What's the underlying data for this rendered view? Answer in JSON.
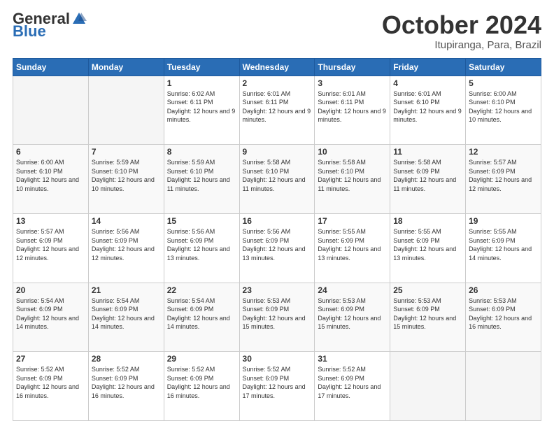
{
  "header": {
    "logo_general": "General",
    "logo_blue": "Blue",
    "month_title": "October 2024",
    "location": "Itupiranga, Para, Brazil"
  },
  "days_of_week": [
    "Sunday",
    "Monday",
    "Tuesday",
    "Wednesday",
    "Thursday",
    "Friday",
    "Saturday"
  ],
  "weeks": [
    [
      {
        "day": "",
        "info": ""
      },
      {
        "day": "",
        "info": ""
      },
      {
        "day": "1",
        "info": "Sunrise: 6:02 AM\nSunset: 6:11 PM\nDaylight: 12 hours and 9 minutes."
      },
      {
        "day": "2",
        "info": "Sunrise: 6:01 AM\nSunset: 6:11 PM\nDaylight: 12 hours and 9 minutes."
      },
      {
        "day": "3",
        "info": "Sunrise: 6:01 AM\nSunset: 6:11 PM\nDaylight: 12 hours and 9 minutes."
      },
      {
        "day": "4",
        "info": "Sunrise: 6:01 AM\nSunset: 6:10 PM\nDaylight: 12 hours and 9 minutes."
      },
      {
        "day": "5",
        "info": "Sunrise: 6:00 AM\nSunset: 6:10 PM\nDaylight: 12 hours and 10 minutes."
      }
    ],
    [
      {
        "day": "6",
        "info": "Sunrise: 6:00 AM\nSunset: 6:10 PM\nDaylight: 12 hours and 10 minutes."
      },
      {
        "day": "7",
        "info": "Sunrise: 5:59 AM\nSunset: 6:10 PM\nDaylight: 12 hours and 10 minutes."
      },
      {
        "day": "8",
        "info": "Sunrise: 5:59 AM\nSunset: 6:10 PM\nDaylight: 12 hours and 11 minutes."
      },
      {
        "day": "9",
        "info": "Sunrise: 5:58 AM\nSunset: 6:10 PM\nDaylight: 12 hours and 11 minutes."
      },
      {
        "day": "10",
        "info": "Sunrise: 5:58 AM\nSunset: 6:10 PM\nDaylight: 12 hours and 11 minutes."
      },
      {
        "day": "11",
        "info": "Sunrise: 5:58 AM\nSunset: 6:09 PM\nDaylight: 12 hours and 11 minutes."
      },
      {
        "day": "12",
        "info": "Sunrise: 5:57 AM\nSunset: 6:09 PM\nDaylight: 12 hours and 12 minutes."
      }
    ],
    [
      {
        "day": "13",
        "info": "Sunrise: 5:57 AM\nSunset: 6:09 PM\nDaylight: 12 hours and 12 minutes."
      },
      {
        "day": "14",
        "info": "Sunrise: 5:56 AM\nSunset: 6:09 PM\nDaylight: 12 hours and 12 minutes."
      },
      {
        "day": "15",
        "info": "Sunrise: 5:56 AM\nSunset: 6:09 PM\nDaylight: 12 hours and 13 minutes."
      },
      {
        "day": "16",
        "info": "Sunrise: 5:56 AM\nSunset: 6:09 PM\nDaylight: 12 hours and 13 minutes."
      },
      {
        "day": "17",
        "info": "Sunrise: 5:55 AM\nSunset: 6:09 PM\nDaylight: 12 hours and 13 minutes."
      },
      {
        "day": "18",
        "info": "Sunrise: 5:55 AM\nSunset: 6:09 PM\nDaylight: 12 hours and 13 minutes."
      },
      {
        "day": "19",
        "info": "Sunrise: 5:55 AM\nSunset: 6:09 PM\nDaylight: 12 hours and 14 minutes."
      }
    ],
    [
      {
        "day": "20",
        "info": "Sunrise: 5:54 AM\nSunset: 6:09 PM\nDaylight: 12 hours and 14 minutes."
      },
      {
        "day": "21",
        "info": "Sunrise: 5:54 AM\nSunset: 6:09 PM\nDaylight: 12 hours and 14 minutes."
      },
      {
        "day": "22",
        "info": "Sunrise: 5:54 AM\nSunset: 6:09 PM\nDaylight: 12 hours and 14 minutes."
      },
      {
        "day": "23",
        "info": "Sunrise: 5:53 AM\nSunset: 6:09 PM\nDaylight: 12 hours and 15 minutes."
      },
      {
        "day": "24",
        "info": "Sunrise: 5:53 AM\nSunset: 6:09 PM\nDaylight: 12 hours and 15 minutes."
      },
      {
        "day": "25",
        "info": "Sunrise: 5:53 AM\nSunset: 6:09 PM\nDaylight: 12 hours and 15 minutes."
      },
      {
        "day": "26",
        "info": "Sunrise: 5:53 AM\nSunset: 6:09 PM\nDaylight: 12 hours and 16 minutes."
      }
    ],
    [
      {
        "day": "27",
        "info": "Sunrise: 5:52 AM\nSunset: 6:09 PM\nDaylight: 12 hours and 16 minutes."
      },
      {
        "day": "28",
        "info": "Sunrise: 5:52 AM\nSunset: 6:09 PM\nDaylight: 12 hours and 16 minutes."
      },
      {
        "day": "29",
        "info": "Sunrise: 5:52 AM\nSunset: 6:09 PM\nDaylight: 12 hours and 16 minutes."
      },
      {
        "day": "30",
        "info": "Sunrise: 5:52 AM\nSunset: 6:09 PM\nDaylight: 12 hours and 17 minutes."
      },
      {
        "day": "31",
        "info": "Sunrise: 5:52 AM\nSunset: 6:09 PM\nDaylight: 12 hours and 17 minutes."
      },
      {
        "day": "",
        "info": ""
      },
      {
        "day": "",
        "info": ""
      }
    ]
  ]
}
